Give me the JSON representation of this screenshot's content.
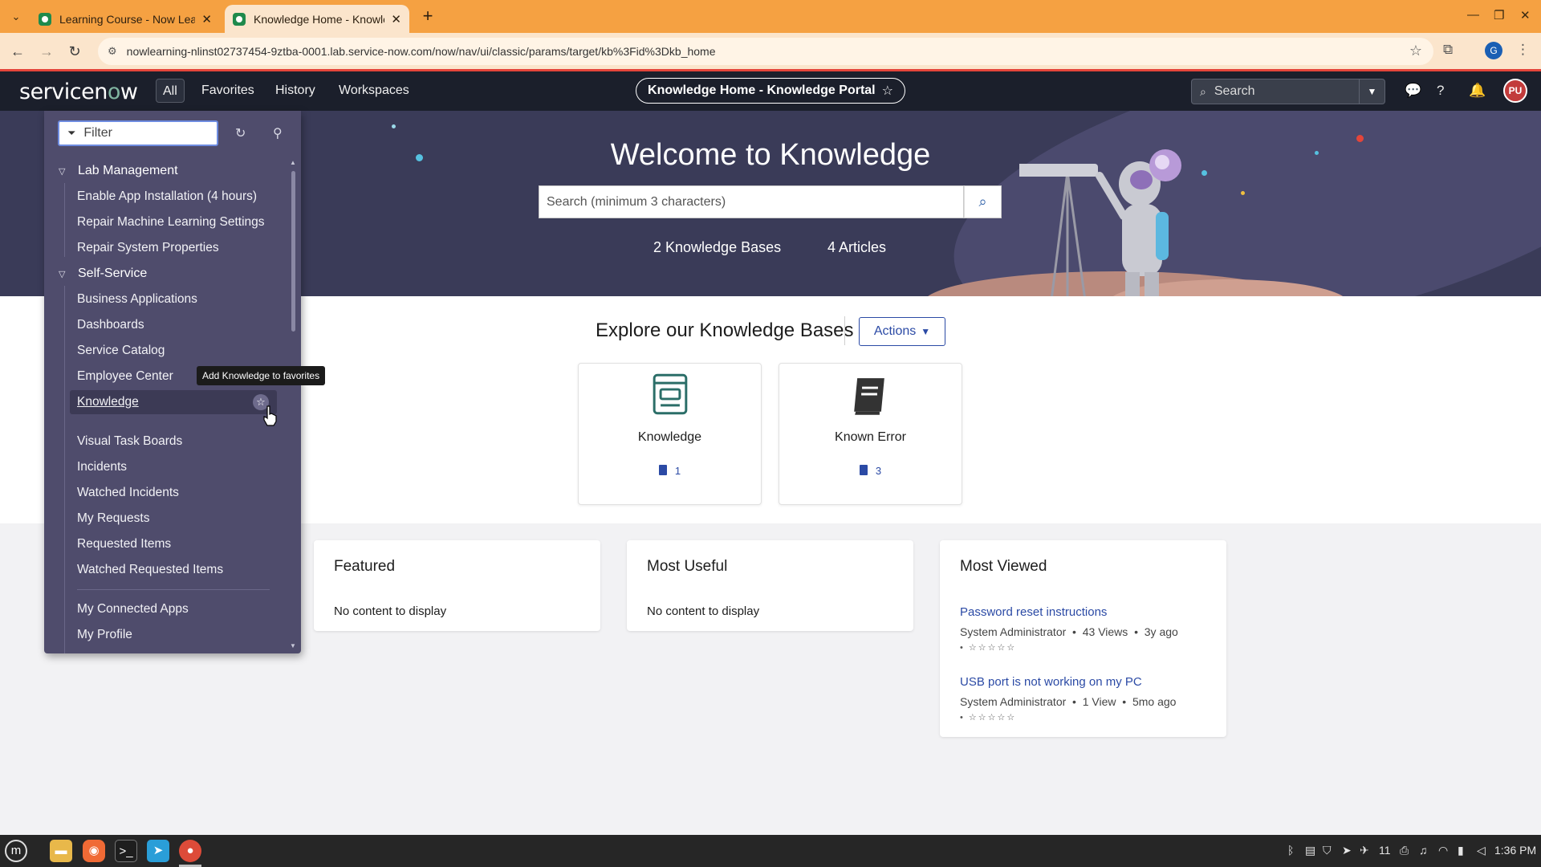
{
  "browser": {
    "tabs": [
      {
        "title": "Learning Course - Now Learn",
        "active": false
      },
      {
        "title": "Knowledge Home - Knowled",
        "active": true
      }
    ],
    "url": "nowlearning-nlinst02737454-9ztba-0001.lab.service-now.com/now/nav/ui/classic/params/target/kb%3Fid%3Dkb_home",
    "profile_initial": "G"
  },
  "header": {
    "logo": "servicenow",
    "nav": [
      "All",
      "Favorites",
      "History",
      "Workspaces"
    ],
    "context_title": "Knowledge Home - Knowledge Portal",
    "search_placeholder": "Search",
    "avatar_initials": "PU"
  },
  "hero": {
    "title": "Welcome to Knowledge",
    "search_placeholder": "Search (minimum 3 characters)",
    "stats": [
      "2 Knowledge Bases",
      "4 Articles"
    ]
  },
  "explore": {
    "title": "Explore our Knowledge Bases",
    "actions_label": "Actions",
    "cards": [
      {
        "name": "Knowledge",
        "count": "1",
        "icon": "knowledge-base-icon"
      },
      {
        "name": "Known Error",
        "count": "3",
        "icon": "book-icon"
      }
    ]
  },
  "panels": {
    "featured": {
      "title": "Featured",
      "empty": "No content to display"
    },
    "most_useful": {
      "title": "Most Useful",
      "empty": "No content to display"
    },
    "most_viewed": {
      "title": "Most Viewed",
      "articles": [
        {
          "title": "Password reset instructions",
          "author": "System Administrator",
          "views": "43 Views",
          "age": "3y ago",
          "rating": 0
        },
        {
          "title": "USB port is not working on my PC",
          "author": "System Administrator",
          "views": "1 View",
          "age": "5mo ago",
          "rating": 0
        }
      ]
    }
  },
  "navigator": {
    "filter_placeholder": "Filter",
    "sections": [
      {
        "title": "Lab Management",
        "items": [
          "Enable App Installation (4 hours)",
          "Repair Machine Learning Settings",
          "Repair System Properties"
        ]
      },
      {
        "title": "Self-Service",
        "items": [
          "Business Applications",
          "Dashboards",
          "Service Catalog",
          "Employee Center",
          "Knowledge",
          "Visual Task Boards",
          "Incidents",
          "Watched Incidents",
          "My Requests",
          "Requested Items",
          "Watched Requested Items",
          "My Connected Apps",
          "My Profile"
        ]
      }
    ],
    "selected_item": "Knowledge",
    "tooltip": "Add Knowledge to favorites"
  },
  "taskbar": {
    "clock": "1:36 PM",
    "tray_count": "11"
  },
  "colors": {
    "accent": "#2b4aa5",
    "header_bg": "#1b1f2b",
    "hero_bg": "#3a3b58",
    "navigator_bg": "#4f4c6c",
    "browser_frame": "#f5a142"
  }
}
